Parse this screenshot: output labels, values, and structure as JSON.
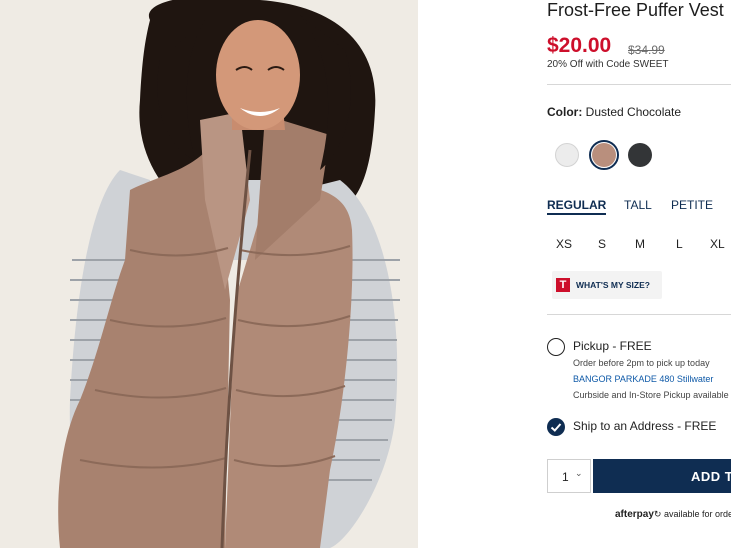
{
  "product": {
    "title": "Frost-Free Puffer Vest",
    "price": "$20.00",
    "original_price": "$34.99",
    "promo": "20% Off with Code SWEET"
  },
  "color": {
    "label": "Color:",
    "selected": "Dusted Chocolate",
    "swatches": [
      "#e9e9e9",
      "#b98f7d",
      "#333537"
    ]
  },
  "fit_tabs": [
    "REGULAR",
    "TALL",
    "PETITE"
  ],
  "sizes": [
    "XS",
    "S",
    "M",
    "L",
    "XL"
  ],
  "size_help": {
    "logo": "T",
    "label": "WHAT'S MY SIZE?"
  },
  "pickup": {
    "label": "Pickup - FREE",
    "note": "Order before 2pm to pick up today",
    "store": "BANGOR PARKADE 480 Stillwater",
    "methods": "Curbside and In-Store Pickup available"
  },
  "ship": {
    "label": "Ship to an Address - FREE"
  },
  "cart": {
    "quantity": "1",
    "add_label": "ADD TO BAG"
  },
  "afterpay": {
    "brand": "afterpay",
    "text": "available for orders"
  },
  "colors": {
    "sale_red": "#cd0f2b",
    "navy": "#0f2d52"
  }
}
